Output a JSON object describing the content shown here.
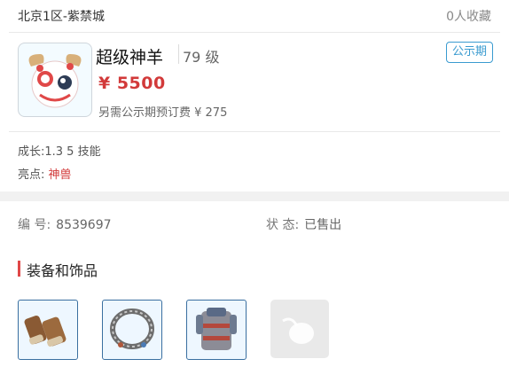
{
  "header": {
    "server": "北京1区-紫禁城",
    "favorites": "0人收藏"
  },
  "listing": {
    "name": "超级神羊",
    "level": "79 级",
    "price": "¥ 5500",
    "fee": "另需公示期预订费 ¥ 275",
    "badge": "公示期",
    "growth": "成长:1.3  5 技能",
    "highlight_label": "亮点: ",
    "highlight_value": "神兽"
  },
  "details": {
    "id_label": "编 号:",
    "id_value": "8539697",
    "status_label": "状 态:",
    "status_value": "已售出"
  },
  "equipment": {
    "title": "装备和饰品",
    "items": [
      {
        "icon": "bracer-icon"
      },
      {
        "icon": "necklace-icon"
      },
      {
        "icon": "armor-icon"
      },
      {
        "icon": "empty-slot-icon"
      }
    ]
  },
  "colors": {
    "price": "#d23a3a",
    "badge": "#3a9bd0",
    "accent_bar": "#e04848"
  }
}
